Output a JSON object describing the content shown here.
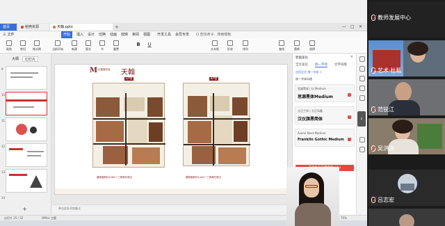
{
  "app": {
    "tabs": [
      {
        "label": "首页"
      },
      {
        "label": "稻壳资源"
      },
      {
        "label": "天翰.pptx"
      }
    ],
    "menu": [
      "三 文件",
      "开始",
      "插入",
      "设计",
      "切换",
      "动画",
      "放映",
      "审阅",
      "视图",
      "开发工具",
      "会员专享"
    ],
    "menu_active_index": 1,
    "search_placeholder": "Q 查找命令、搜索模板",
    "ribbon": [
      "粘贴",
      "剪切",
      "格式刷",
      "当前开始",
      "新建",
      "版式",
      "节",
      "重置",
      "B",
      "U",
      "文本框",
      "形状",
      "排列",
      "查找",
      "替换",
      "选择"
    ],
    "thumb_tabs": [
      "大纲",
      "幻灯片"
    ],
    "thumb_active_tab": 1,
    "thumb_numbers": [
      "9",
      "10",
      "11",
      "12",
      "13",
      "14"
    ],
    "notes_placeholder": "单击此处添加备注",
    "status": {
      "slide": "幻灯片 25 / 32",
      "theme": "Office 主题",
      "zoom": "75%"
    },
    "slide": {
      "brand": "M",
      "brand_sub": "红星美凯龙",
      "title": "天翰",
      "plan_a_label": "A户型",
      "plan_b_label": "B户型",
      "plan_a_caption": "建筑面积约128m²  三房两厅两卫",
      "plan_b_caption": "建筑面积约120m²  三房两厅两卫"
    },
    "right_panel": {
      "title": "智能美化",
      "tabs": [
        "全文美化",
        "统一字体",
        "文字排版"
      ],
      "active_tab": 1,
      "link": "应用全文 统一字体 >",
      "section": "统一字体风格",
      "fonts": [
        {
          "name": "思源黑体 | Lt Medium",
          "sample": "思源黑体Medium"
        },
        {
          "name": "方正兰亭 | 方正风雅",
          "sample": "汉仪旗黑简体"
        },
        {
          "name": "Avenir Next Medium",
          "sample": "Franklin Gothic Medium"
        }
      ],
      "apply_button": "开通会员应用字体 ( 1 )",
      "note": "使用后 文字效果将自动适应"
    }
  },
  "participants": [
    {
      "name": "教师发展中心",
      "muted": true
    },
    {
      "name": "艺术·杜甄",
      "muted": true
    },
    {
      "name": "范锐江",
      "muted": true
    },
    {
      "name": "吴洪涛",
      "muted": true
    },
    {
      "name": "吕志宏",
      "muted": true
    }
  ]
}
